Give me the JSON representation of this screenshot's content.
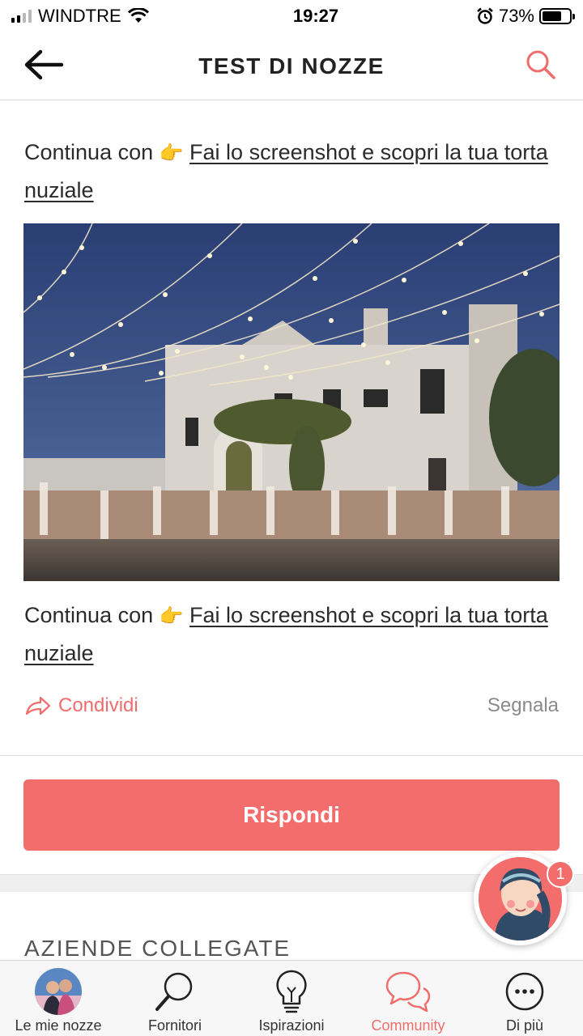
{
  "status_bar": {
    "carrier": "WINDTRE",
    "time": "19:27",
    "battery_percent": "73%",
    "battery_level": 0.73,
    "icons": [
      "signal-icon",
      "wifi-icon",
      "alarm-icon",
      "battery-icon"
    ]
  },
  "header": {
    "title": "TEST DI NOZZE",
    "back_icon": "back-arrow-icon",
    "search_icon": "search-icon"
  },
  "post": {
    "prefix": "Continua con",
    "emoji": "👉",
    "link_text": "Fai lo screenshot e scopri la tua torta nuziale",
    "photo": "wedding-venue-photo",
    "share_label": "Condividi",
    "report_label": "Segnala"
  },
  "reply_button": {
    "label": "Rispondi"
  },
  "related_section": {
    "title": "AZIENDE COLLEGATE"
  },
  "chat": {
    "badge_count": "1"
  },
  "tabbar": {
    "items": [
      {
        "label": "Le mie nozze",
        "icon": "profile-avatar"
      },
      {
        "label": "Fornitori",
        "icon": "magnifier-icon"
      },
      {
        "label": "Ispirazioni",
        "icon": "lightbulb-icon"
      },
      {
        "label": "Community",
        "icon": "chat-bubbles-icon",
        "active": true
      },
      {
        "label": "Di più",
        "icon": "more-dots-icon"
      }
    ]
  },
  "colors": {
    "accent": "#f36d6d",
    "text": "#2b2b2b",
    "muted": "#8a8a8a"
  }
}
